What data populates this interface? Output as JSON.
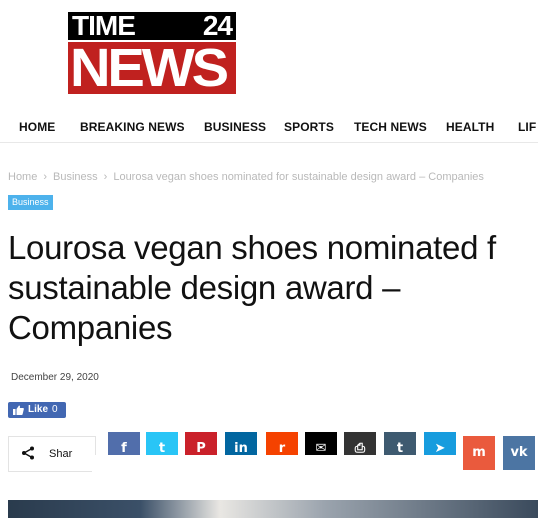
{
  "logo": {
    "line1_left": "TIME",
    "line1_right": "24",
    "line2": "NEWS"
  },
  "nav": {
    "items": [
      "HOME",
      "BREAKING NEWS",
      "BUSINESS",
      "SPORTS",
      "TECH NEWS",
      "HEALTH",
      "LIF"
    ]
  },
  "breadcrumb": {
    "items": [
      "Home",
      "Business",
      "Lourosa vegan shoes nominated for sustainable design award – Companies"
    ],
    "separator": "›"
  },
  "category_badge": "Business",
  "article": {
    "title_lines": [
      "Lourosa vegan shoes nominated f",
      "sustainable design award –",
      "Companies"
    ],
    "date": "December 29, 2020"
  },
  "like_button": {
    "icon": "thumbs-up-icon",
    "label": "Like",
    "count": "0"
  },
  "share": {
    "icon": "share-icon",
    "label": "Shar"
  },
  "share_buttons": [
    {
      "name": "facebook",
      "glyph": "f",
      "color": "#516eab"
    },
    {
      "name": "twitter",
      "glyph": "t",
      "color": "#29c5f6"
    },
    {
      "name": "pinterest",
      "glyph": "P",
      "color": "#ca212a"
    },
    {
      "name": "linkedin",
      "glyph": "in",
      "color": "#0266a0"
    },
    {
      "name": "reddit",
      "glyph": "r",
      "color": "#f54200"
    },
    {
      "name": "email",
      "glyph": "✉",
      "color": "#000000"
    },
    {
      "name": "print",
      "glyph": "⎙",
      "color": "#333333"
    },
    {
      "name": "tumblr",
      "glyph": "t",
      "color": "#3e5a70"
    },
    {
      "name": "telegram",
      "glyph": "➤",
      "color": "#179cde"
    },
    {
      "name": "mix",
      "glyph": "m",
      "color": "#ea5a3d"
    },
    {
      "name": "vk",
      "glyph": "vk",
      "color": "#4c75a3"
    }
  ]
}
